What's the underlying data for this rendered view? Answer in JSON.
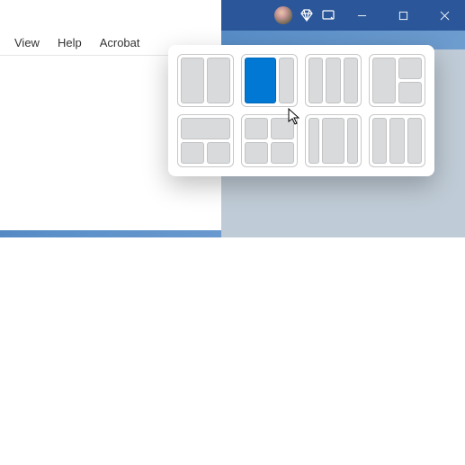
{
  "menubar": {
    "view": "View",
    "help": "Help",
    "acrobat": "Acrobat"
  },
  "colors": {
    "titlebar": "#2b579a",
    "accent": "#0078d4",
    "zone_fill": "#d9dadb"
  },
  "snap_layouts": {
    "selected_layout_index": 1,
    "selected_zone_index": 0,
    "layouts": [
      {
        "id": "two-halves",
        "zones": 2
      },
      {
        "id": "two-thirds-one-third",
        "zones": 2
      },
      {
        "id": "three-columns",
        "zones": 3
      },
      {
        "id": "half-plus-stack",
        "zones": 3
      },
      {
        "id": "top-plus-two",
        "zones": 3
      },
      {
        "id": "quad",
        "zones": 4
      },
      {
        "id": "wide-center",
        "zones": 3
      },
      {
        "id": "three-uneven",
        "zones": 3
      }
    ]
  }
}
